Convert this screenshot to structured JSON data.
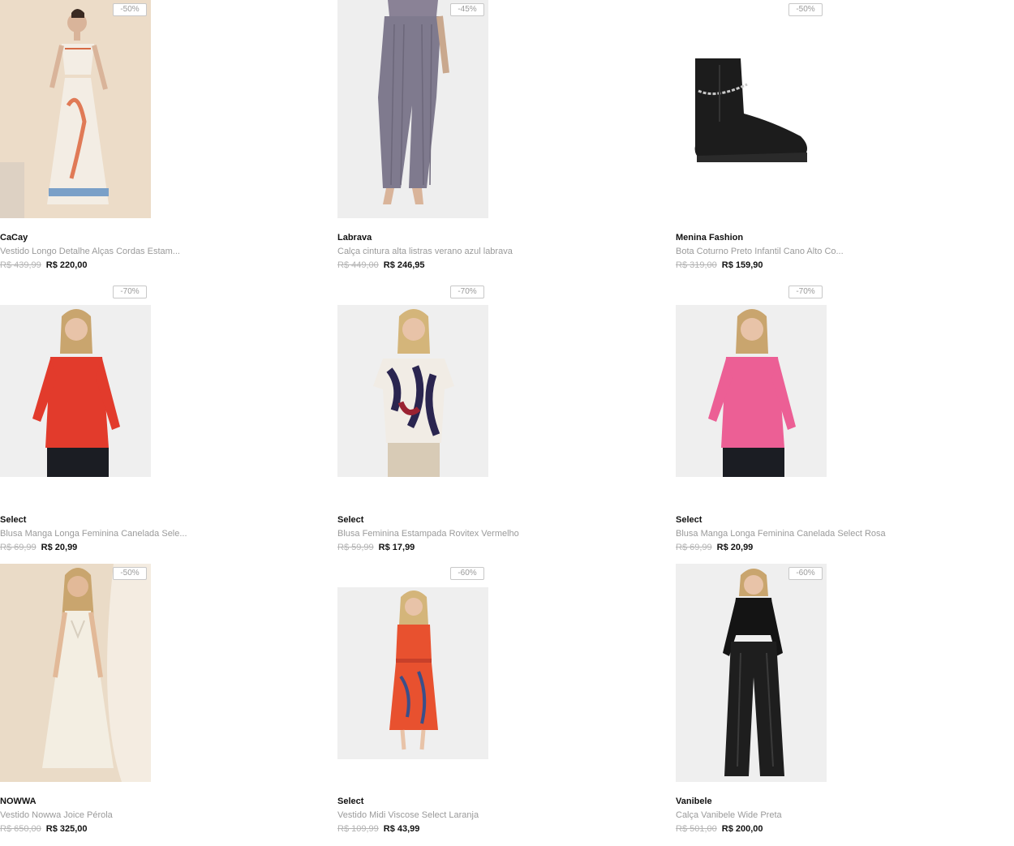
{
  "products": [
    {
      "badge": "-50%",
      "brand": "CaCay",
      "name": "Vestido Longo Detalhe Alças Cordas Estam...",
      "old_price": "R$ 439,99",
      "price": "R$ 220,00",
      "icon": "long-dress-photo"
    },
    {
      "badge": "-45%",
      "brand": "Labrava",
      "name": "Calça cintura alta listras verano azul labrava",
      "old_price": "R$ 449,00",
      "price": "R$ 246,95",
      "icon": "striped-pants-photo"
    },
    {
      "badge": "-50%",
      "brand": "Menina Fashion",
      "name": "Bota Coturno Preto Infantil Cano Alto Co...",
      "old_price": "R$ 319,00",
      "price": "R$ 159,90",
      "icon": "black-boot-photo"
    },
    {
      "badge": "-70%",
      "brand": "Select",
      "name": "Blusa Manga Longa Feminina Canelada Sele...",
      "old_price": "R$ 69,99",
      "price": "R$ 20,99",
      "icon": "red-blouse-photo"
    },
    {
      "badge": "-70%",
      "brand": "Select",
      "name": "Blusa Feminina Estampada Rovitex Vermelho",
      "old_price": "R$ 59,99",
      "price": "R$ 17,99",
      "icon": "printed-blouse-photo"
    },
    {
      "badge": "-70%",
      "brand": "Select",
      "name": "Blusa Manga Longa Feminina Canelada Select Rosa",
      "old_price": "R$ 69,99",
      "price": "R$ 20,99",
      "icon": "pink-blouse-photo"
    },
    {
      "badge": "-50%",
      "brand": "NOWWA",
      "name": "Vestido Nowwa Joice Pérola",
      "old_price": "R$ 650,00",
      "price": "R$ 325,00",
      "icon": "cream-dress-photo"
    },
    {
      "badge": "-60%",
      "brand": "Select",
      "name": "Vestido Midi Viscose Select Laranja",
      "old_price": "R$ 109,99",
      "price": "R$ 43,99",
      "icon": "orange-dress-photo"
    },
    {
      "badge": "-60%",
      "brand": "Vanibele",
      "name": "Calça Vanibele Wide Preta",
      "old_price": "R$ 501,00",
      "price": "R$ 200,00",
      "icon": "black-pants-photo"
    }
  ]
}
